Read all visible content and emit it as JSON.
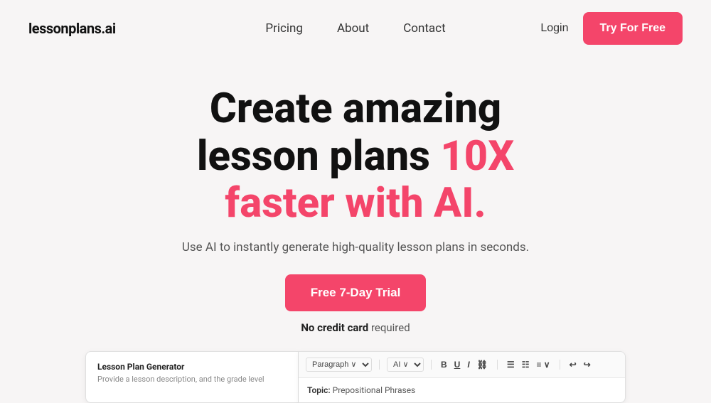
{
  "brand": {
    "logo_text": "lessonplans.ai"
  },
  "navbar": {
    "links": [
      {
        "label": "Pricing",
        "href": "#"
      },
      {
        "label": "About",
        "href": "#"
      },
      {
        "label": "Contact",
        "href": "#"
      }
    ],
    "login_label": "Login",
    "cta_label": "Try For Free"
  },
  "hero": {
    "title_line1": "Create amazing",
    "title_line2": "lesson plans ",
    "title_highlight": "10X",
    "title_line3": "faster with AI.",
    "subtitle": "Use AI to instantly generate high-quality lesson plans in seconds.",
    "trial_button": "Free 7-Day Trial",
    "no_cc_bold": "No credit card",
    "no_cc_rest": " required"
  },
  "preview": {
    "left_card_title": "Lesson Plan Generator",
    "left_card_subtitle": "Provide a lesson description, and the grade level",
    "toolbar": {
      "paragraph_select": "Paragraph ∨",
      "ai_select": "AI ∨",
      "bold": "B",
      "underline": "U",
      "italic": "I",
      "link": "🔗",
      "bullet_list": "≡",
      "ordered_list": "≡",
      "indent": "≡ ∨",
      "undo": "↩",
      "redo": "↪"
    },
    "editor_topic_label": "Topic:",
    "editor_topic_value": "Prepositional Phrases"
  },
  "colors": {
    "accent": "#f4456a",
    "background": "#f7f5f5",
    "text_dark": "#111111",
    "text_muted": "#555555"
  }
}
